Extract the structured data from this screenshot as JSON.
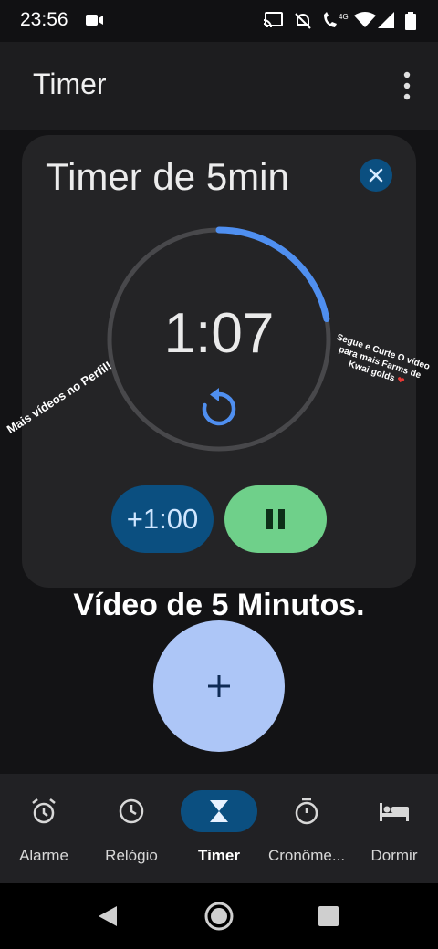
{
  "status_bar": {
    "time": "23:56",
    "icons": [
      "video-record-icon",
      "cast-icon",
      "do-not-disturb-icon",
      "volte-call-icon",
      "4g-icon",
      "wifi-icon",
      "signal-icon",
      "battery-icon"
    ]
  },
  "app_bar": {
    "title": "Timer",
    "overflow_icon": "more-vert-icon"
  },
  "timer_card": {
    "label": "Timer de 5min",
    "time_remaining": "1:07",
    "total_seconds": 300,
    "remaining_seconds": 67,
    "elapsed_fraction": 0.22,
    "add_minute_label": "+1:00",
    "close_icon": "close-icon",
    "reset_icon": "reset-icon",
    "pause_icon": "pause-icon"
  },
  "overlays": {
    "left_text": "Mais vídeos no Perfil!",
    "right_text": "Segue e Curte O vídeo para mais Farms de Kwai golds",
    "right_heart": "❤"
  },
  "caption": "Vídeo de 5 Minutos.",
  "fab": {
    "icon": "add-icon"
  },
  "bottom_nav": {
    "items": [
      {
        "label": "Alarme",
        "icon": "alarm-icon",
        "active": false
      },
      {
        "label": "Relógio",
        "icon": "clock-icon",
        "active": false
      },
      {
        "label": "Timer",
        "icon": "hourglass-icon",
        "active": true
      },
      {
        "label": "Cronôme...",
        "icon": "stopwatch-icon",
        "active": false
      },
      {
        "label": "Dormir",
        "icon": "bed-icon",
        "active": false
      }
    ]
  },
  "system_nav": {
    "icons": [
      "back-icon",
      "home-icon",
      "recents-icon"
    ]
  },
  "colors": {
    "accent_blue": "#4f8ff0",
    "pill_blue": "#0b4f80",
    "pause_green": "#6fd08a",
    "fab_blue": "#adc6f7"
  }
}
